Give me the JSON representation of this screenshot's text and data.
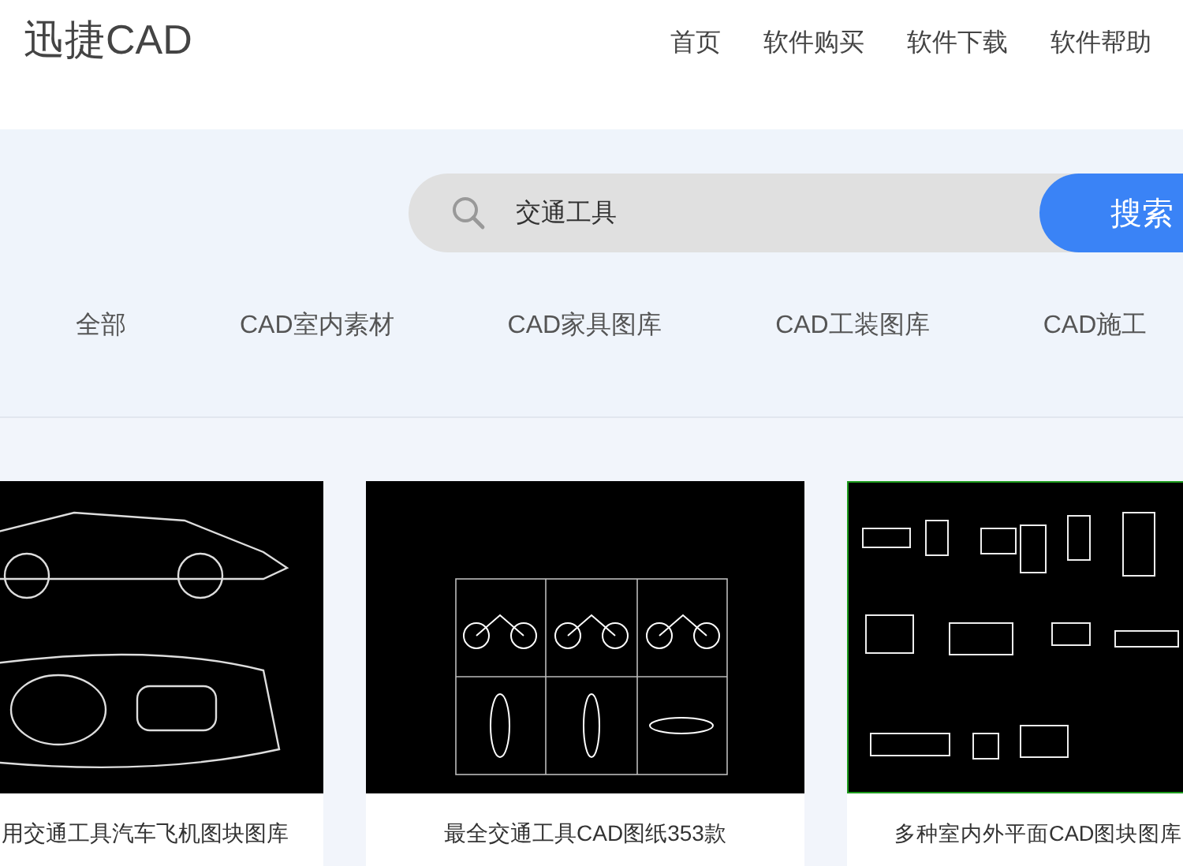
{
  "header": {
    "logo": "迅捷CAD",
    "nav": [
      {
        "label": "首页"
      },
      {
        "label": "软件购买"
      },
      {
        "label": "软件下载"
      },
      {
        "label": "软件帮助"
      }
    ]
  },
  "search": {
    "value": "交通工具",
    "button": "搜索"
  },
  "categories": [
    {
      "label": "全部"
    },
    {
      "label": "CAD室内素材"
    },
    {
      "label": "CAD家具图库"
    },
    {
      "label": "CAD工装图库"
    },
    {
      "label": "CAD施工"
    }
  ],
  "cards": [
    {
      "kind": "cars",
      "title": "用交通工具汽车飞机图块图库"
    },
    {
      "kind": "motorcycles",
      "title": "最全交通工具CAD图纸353款"
    },
    {
      "kind": "playground",
      "title": "多种室内外平面CAD图块图库"
    }
  ]
}
